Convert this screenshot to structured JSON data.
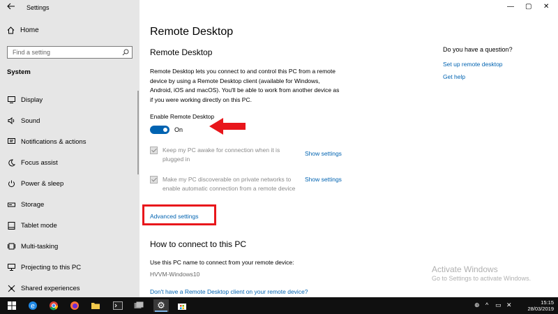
{
  "window": {
    "app_title": "Settings",
    "minimize": "—",
    "maximize": "▢",
    "close": "✕"
  },
  "sidebar": {
    "home_label": "Home",
    "search_placeholder": "Find a setting",
    "section": "System",
    "items": [
      {
        "label": "Display",
        "icon": "display-icon"
      },
      {
        "label": "Sound",
        "icon": "speaker-icon"
      },
      {
        "label": "Notifications & actions",
        "icon": "notifications-icon"
      },
      {
        "label": "Focus assist",
        "icon": "moon-icon"
      },
      {
        "label": "Power & sleep",
        "icon": "power-icon"
      },
      {
        "label": "Storage",
        "icon": "storage-icon"
      },
      {
        "label": "Tablet mode",
        "icon": "tablet-icon"
      },
      {
        "label": "Multi-tasking",
        "icon": "multitask-icon"
      },
      {
        "label": "Projecting to this PC",
        "icon": "project-icon"
      },
      {
        "label": "Shared experiences",
        "icon": "shared-icon"
      }
    ]
  },
  "main": {
    "page_title": "Remote Desktop",
    "section_title": "Remote Desktop",
    "description": "Remote Desktop lets you connect to and control this PC from a remote device by using a Remote Desktop client (available for Windows, Android, iOS and macOS). You'll be able to work from another device as if you were working directly on this PC.",
    "enable_label": "Enable Remote Desktop",
    "toggle_state": "On",
    "option1": "Keep my PC awake for connection when it is plugged in",
    "option2": "Make my PC discoverable on private networks to enable automatic connection from a remote device",
    "show_settings": "Show settings",
    "advanced_settings": "Advanced settings",
    "how_title": "How to connect to this PC",
    "use_name": "Use this PC name to connect from your remote device:",
    "pc_name": "HVVM-Windows10",
    "client_link": "Don't have a Remote Desktop client on your remote device?"
  },
  "help": {
    "question": "Do you have a question?",
    "link1": "Set up remote desktop",
    "link2": "Get help"
  },
  "watermark": {
    "line1": "Activate Windows",
    "line2": "Go to Settings to activate Windows."
  },
  "taskbar": {
    "time": "15:15",
    "date": "28/03/2019"
  },
  "colors": {
    "accent": "#0063b1",
    "highlight": "#e8161b"
  }
}
